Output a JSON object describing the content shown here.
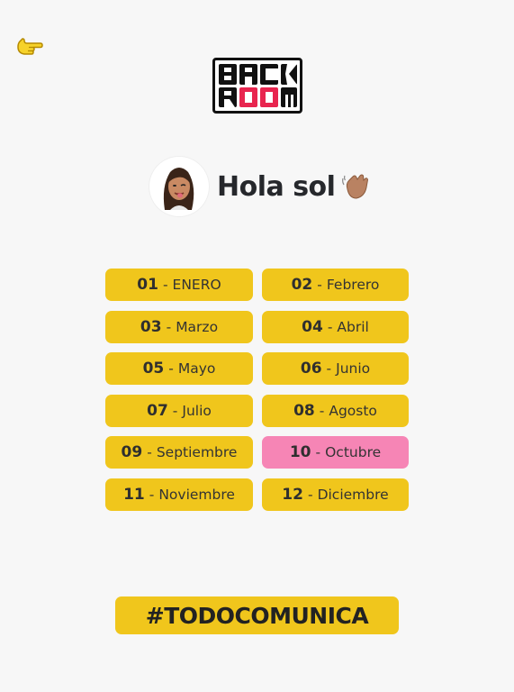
{
  "header": {
    "back_icon": "pointing-hand-icon",
    "logo_text": "BACK ROOM"
  },
  "greeting": {
    "text": "Hola sol",
    "avatar_icon": "memoji-avatar",
    "wave_icon": "waving-hand-icon"
  },
  "months": [
    {
      "num": "01",
      "name": "ENERO",
      "active": false
    },
    {
      "num": "02",
      "name": "Febrero",
      "active": false
    },
    {
      "num": "03",
      "name": "Marzo",
      "active": false
    },
    {
      "num": "04",
      "name": "Abril",
      "active": false
    },
    {
      "num": "05",
      "name": "Mayo",
      "active": false
    },
    {
      "num": "06",
      "name": "Junio",
      "active": false
    },
    {
      "num": "07",
      "name": "Julio",
      "active": false
    },
    {
      "num": "08",
      "name": "Agosto",
      "active": false
    },
    {
      "num": "09",
      "name": "Septiembre",
      "active": false
    },
    {
      "num": "10",
      "name": "Octubre",
      "active": true
    },
    {
      "num": "11",
      "name": "Noviembre",
      "active": false
    },
    {
      "num": "12",
      "name": "Diciembre",
      "active": false
    }
  ],
  "separator": "-",
  "footer": {
    "hashtag": "#TODOCOMUNICA"
  },
  "colors": {
    "accent_yellow": "#f0c61c",
    "active_pink": "#f685b5",
    "logo_red": "#e8254f"
  }
}
